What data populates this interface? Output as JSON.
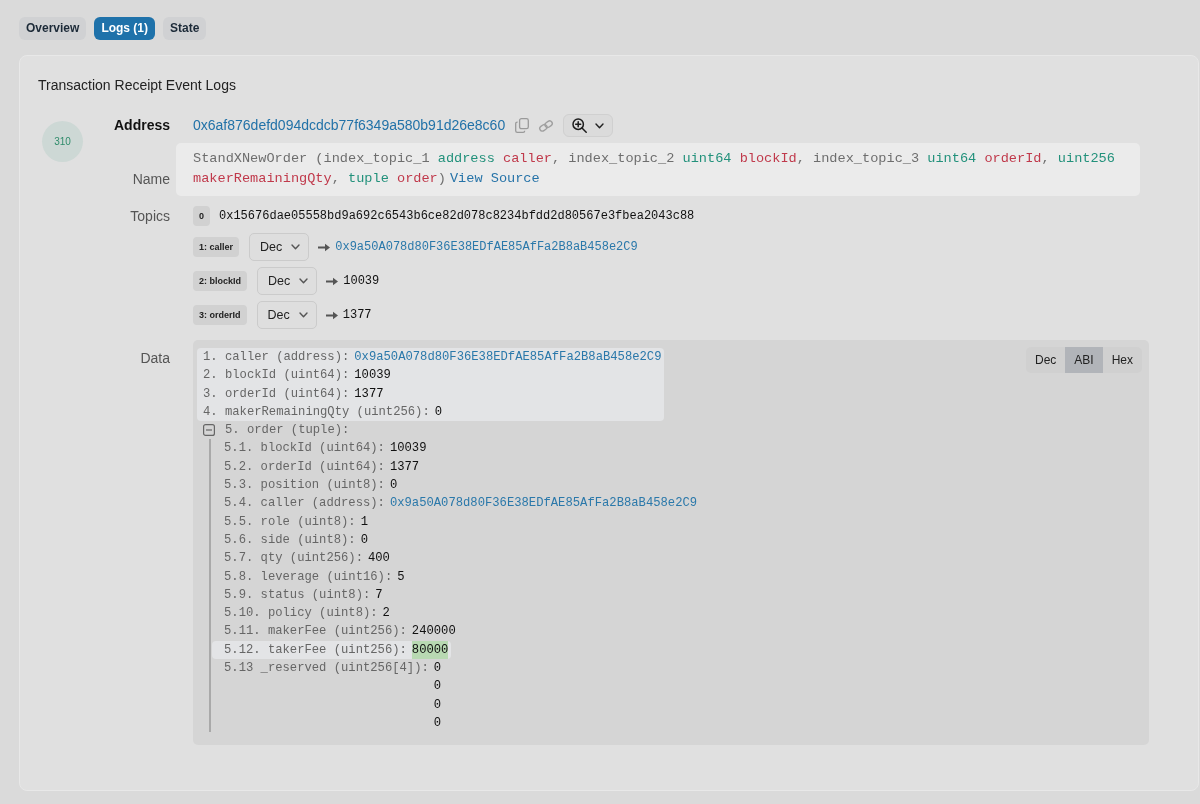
{
  "tabs": [
    {
      "label": "Overview",
      "selected": false
    },
    {
      "label": "Logs (1)",
      "selected": true
    },
    {
      "label": "State",
      "selected": false
    }
  ],
  "card": {
    "title": "Transaction Receipt Event Logs",
    "log": {
      "index": "310",
      "address": {
        "label": "Address",
        "value": "0x6af876defd094dcdcb77f6349a580b91d26e8c60"
      },
      "name": {
        "label": "Name",
        "segments": [
          {
            "kind": "plain",
            "text": "StandXNewOrder (index_topic_1 "
          },
          {
            "kind": "type",
            "text": "address"
          },
          {
            "kind": "param",
            "text": "caller"
          },
          {
            "kind": "plain",
            "text": ", index_topic_2 "
          },
          {
            "kind": "type",
            "text": "uint64"
          },
          {
            "kind": "param",
            "text": "blockId"
          },
          {
            "kind": "plain",
            "text": ", index_topic_3 "
          },
          {
            "kind": "type",
            "text": "uint64"
          },
          {
            "kind": "param",
            "text": "orderId"
          },
          {
            "kind": "plain",
            "text": ", "
          },
          {
            "kind": "type",
            "text": "uint256"
          },
          {
            "kind": "param",
            "text": "makerRemainingQty"
          },
          {
            "kind": "plain",
            "text": ", "
          },
          {
            "kind": "type",
            "text": "tuple"
          },
          {
            "kind": "param",
            "text": "order"
          },
          {
            "kind": "plain",
            "text": ")"
          }
        ],
        "link": "View Source"
      },
      "topics": {
        "label": "Topics",
        "items": [
          {
            "kind": "raw",
            "badge": "0",
            "value": "0x15676dae05558bd9a692c6543b6ce82d078c8234bfdd2d80567e3fbea2043c88"
          },
          {
            "kind": "address",
            "badge": "1: caller",
            "format": "Dec",
            "value": "0x9a50A078d80F36E38EDfAE85AfFa2B8aB458e2C9"
          },
          {
            "kind": "number",
            "badge": "2: blockId",
            "format": "Dec",
            "value": "10039"
          },
          {
            "kind": "number",
            "badge": "3: orderId",
            "format": "Dec",
            "value": "1377"
          }
        ]
      },
      "data": {
        "label": "Data",
        "formats": [
          {
            "label": "Dec",
            "selected": false
          },
          {
            "label": "ABI",
            "selected": true
          },
          {
            "label": "Hex",
            "selected": false
          }
        ],
        "fields": [
          {
            "kind": "address",
            "label": "1. caller (address):",
            "value": "0x9a50A078d80F36E38EDfAE85AfFa2B8aB458e2C9",
            "highlighted": true
          },
          {
            "kind": "number",
            "label": "2. blockId (uint64):",
            "value": "10039",
            "highlighted": true
          },
          {
            "kind": "number",
            "label": "3. orderId (uint64):",
            "value": "1377",
            "highlighted": true
          },
          {
            "kind": "number",
            "label": "4. makerRemainingQty (uint256):",
            "value": "0",
            "highlighted": true
          },
          {
            "kind": "tuple",
            "label": "5. order (tuple):",
            "expanded": true,
            "highlighted": false,
            "children": [
              {
                "kind": "number",
                "label": "5.1. blockId (uint64):",
                "value": "10039",
                "highlighted": false,
                "value_highlighted": false
              },
              {
                "kind": "number",
                "label": "5.2. orderId (uint64):",
                "value": "1377",
                "highlighted": false,
                "value_highlighted": false
              },
              {
                "kind": "number",
                "label": "5.3. position (uint8):",
                "value": "0",
                "highlighted": false,
                "value_highlighted": false
              },
              {
                "kind": "address",
                "label": "5.4. caller (address):",
                "value": "0x9a50A078d80F36E38EDfAE85AfFa2B8aB458e2C9",
                "highlighted": false,
                "value_highlighted": false
              },
              {
                "kind": "number",
                "label": "5.5. role (uint8):",
                "value": "1",
                "highlighted": false,
                "value_highlighted": false
              },
              {
                "kind": "number",
                "label": "5.6. side (uint8):",
                "value": "0",
                "highlighted": false,
                "value_highlighted": false
              },
              {
                "kind": "number",
                "label": "5.7. qty (uint256):",
                "value": "400",
                "highlighted": false,
                "value_highlighted": false
              },
              {
                "kind": "number",
                "label": "5.8. leverage (uint16):",
                "value": "5",
                "highlighted": false,
                "value_highlighted": false
              },
              {
                "kind": "number",
                "label": "5.9. status (uint8):",
                "value": "7",
                "highlighted": false,
                "value_highlighted": false
              },
              {
                "kind": "number",
                "label": "5.10. policy (uint8):",
                "value": "2",
                "highlighted": false,
                "value_highlighted": false
              },
              {
                "kind": "number",
                "label": "5.11. makerFee (uint256):",
                "value": "240000",
                "highlighted": false,
                "value_highlighted": false
              },
              {
                "kind": "number",
                "label": "5.12. takerFee (uint256):",
                "value": "80000",
                "highlighted": true,
                "value_highlighted": true
              },
              {
                "kind": "array",
                "label": "5.13 _reserved (uint256[4]):",
                "values": [
                  "0",
                  "0",
                  "0",
                  "0"
                ],
                "highlighted": false,
                "value_highlighted": false
              }
            ]
          }
        ]
      }
    }
  }
}
